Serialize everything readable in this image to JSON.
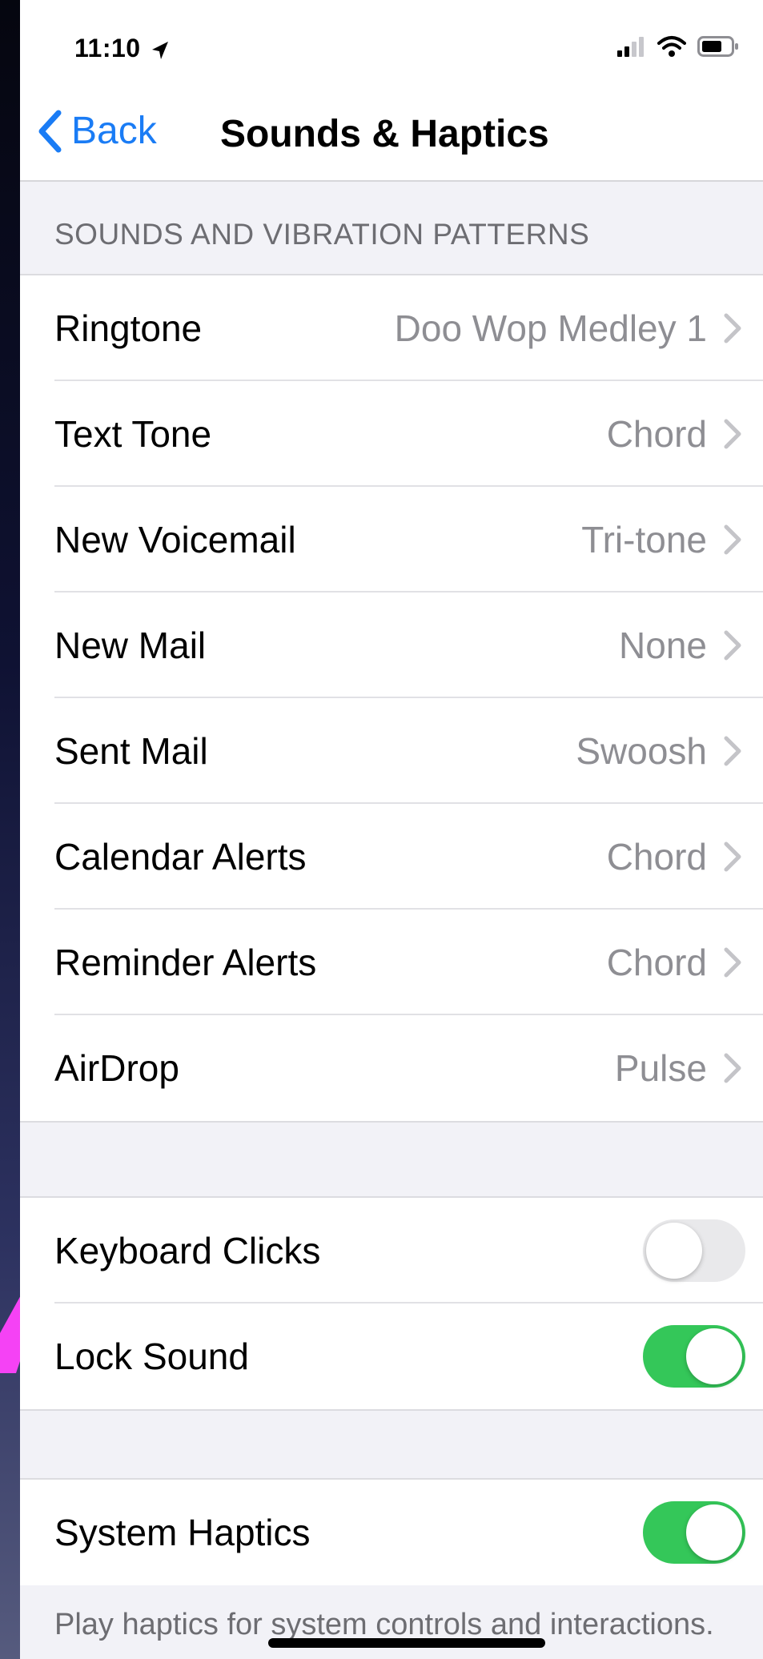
{
  "status_bar": {
    "time": "11:10"
  },
  "nav": {
    "back_label": "Back",
    "title": "Sounds & Haptics"
  },
  "sounds_section": {
    "header": "SOUNDS AND VIBRATION PATTERNS",
    "rows": [
      {
        "label": "Ringtone",
        "value": "Doo Wop Medley 1"
      },
      {
        "label": "Text Tone",
        "value": "Chord"
      },
      {
        "label": "New Voicemail",
        "value": "Tri-tone"
      },
      {
        "label": "New Mail",
        "value": "None"
      },
      {
        "label": "Sent Mail",
        "value": "Swoosh"
      },
      {
        "label": "Calendar Alerts",
        "value": "Chord"
      },
      {
        "label": "Reminder Alerts",
        "value": "Chord"
      },
      {
        "label": "AirDrop",
        "value": "Pulse"
      }
    ]
  },
  "toggles_section": {
    "rows": [
      {
        "label": "Keyboard Clicks",
        "on": false
      },
      {
        "label": "Lock Sound",
        "on": true
      }
    ]
  },
  "haptics_section": {
    "row": {
      "label": "System Haptics",
      "on": true
    },
    "footer": "Play haptics for system controls and interactions."
  },
  "colors": {
    "accent": "#1a7cf5",
    "toggle_on": "#34c759",
    "annotation_arrow": "#f542f5"
  },
  "icons": [
    "location-arrow-icon",
    "cellular-signal-icon",
    "wifi-icon",
    "battery-icon",
    "back-chevron-icon",
    "chevron-right-icon"
  ]
}
